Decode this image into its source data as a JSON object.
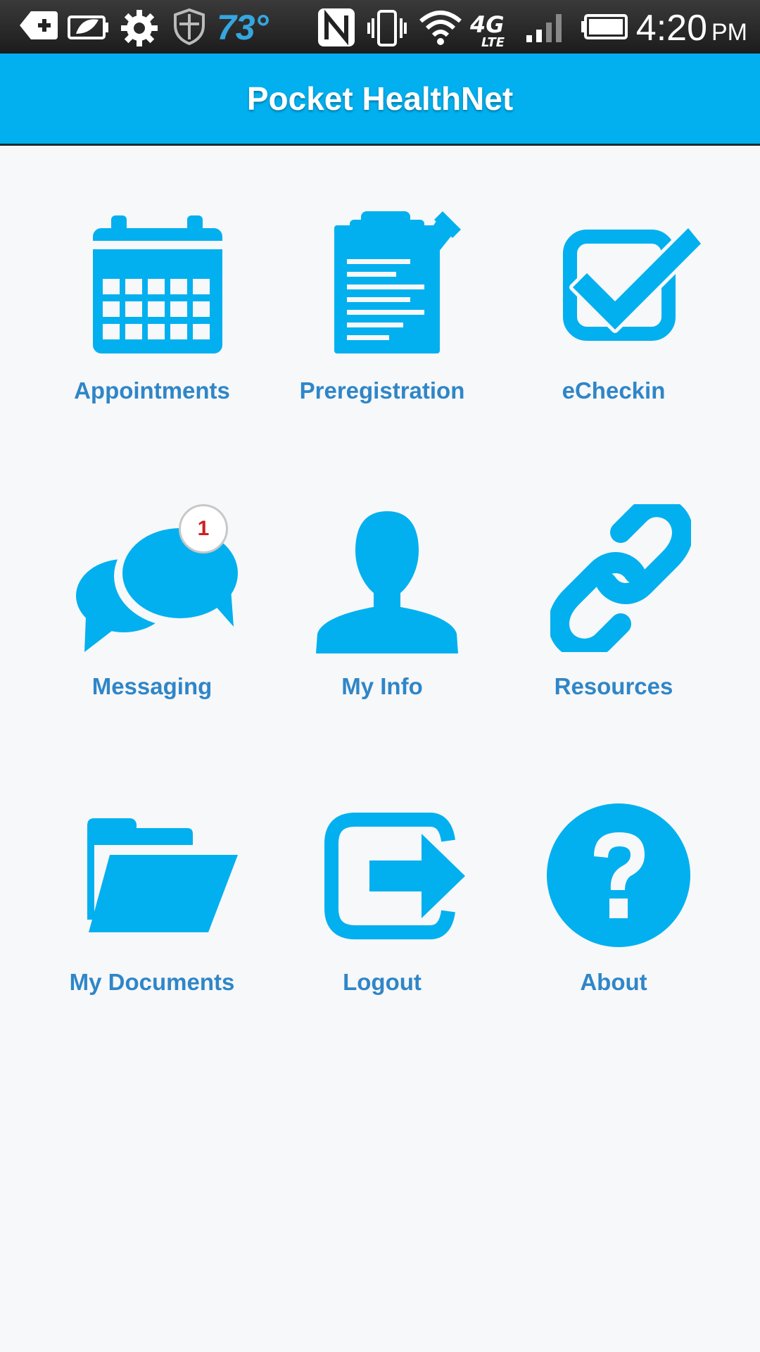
{
  "status_bar": {
    "temperature": "73°",
    "time": "4:20",
    "ampm": "PM",
    "network": "4G LTE"
  },
  "header": {
    "title": "Pocket HealthNet"
  },
  "tiles": [
    {
      "label": "Appointments",
      "icon": "calendar-icon"
    },
    {
      "label": "Preregistration",
      "icon": "clipboard-icon"
    },
    {
      "label": "eCheckin",
      "icon": "checkbox-icon"
    },
    {
      "label": "Messaging",
      "icon": "chat-bubbles-icon",
      "badge": "1"
    },
    {
      "label": "My Info",
      "icon": "person-icon"
    },
    {
      "label": "Resources",
      "icon": "link-icon"
    },
    {
      "label": "My Documents",
      "icon": "folder-icon"
    },
    {
      "label": "Logout",
      "icon": "logout-icon"
    },
    {
      "label": "About",
      "icon": "question-icon"
    }
  ],
  "colors": {
    "accent": "#02b0ef",
    "label": "#2f86c8",
    "badge_text": "#d11f1f"
  }
}
